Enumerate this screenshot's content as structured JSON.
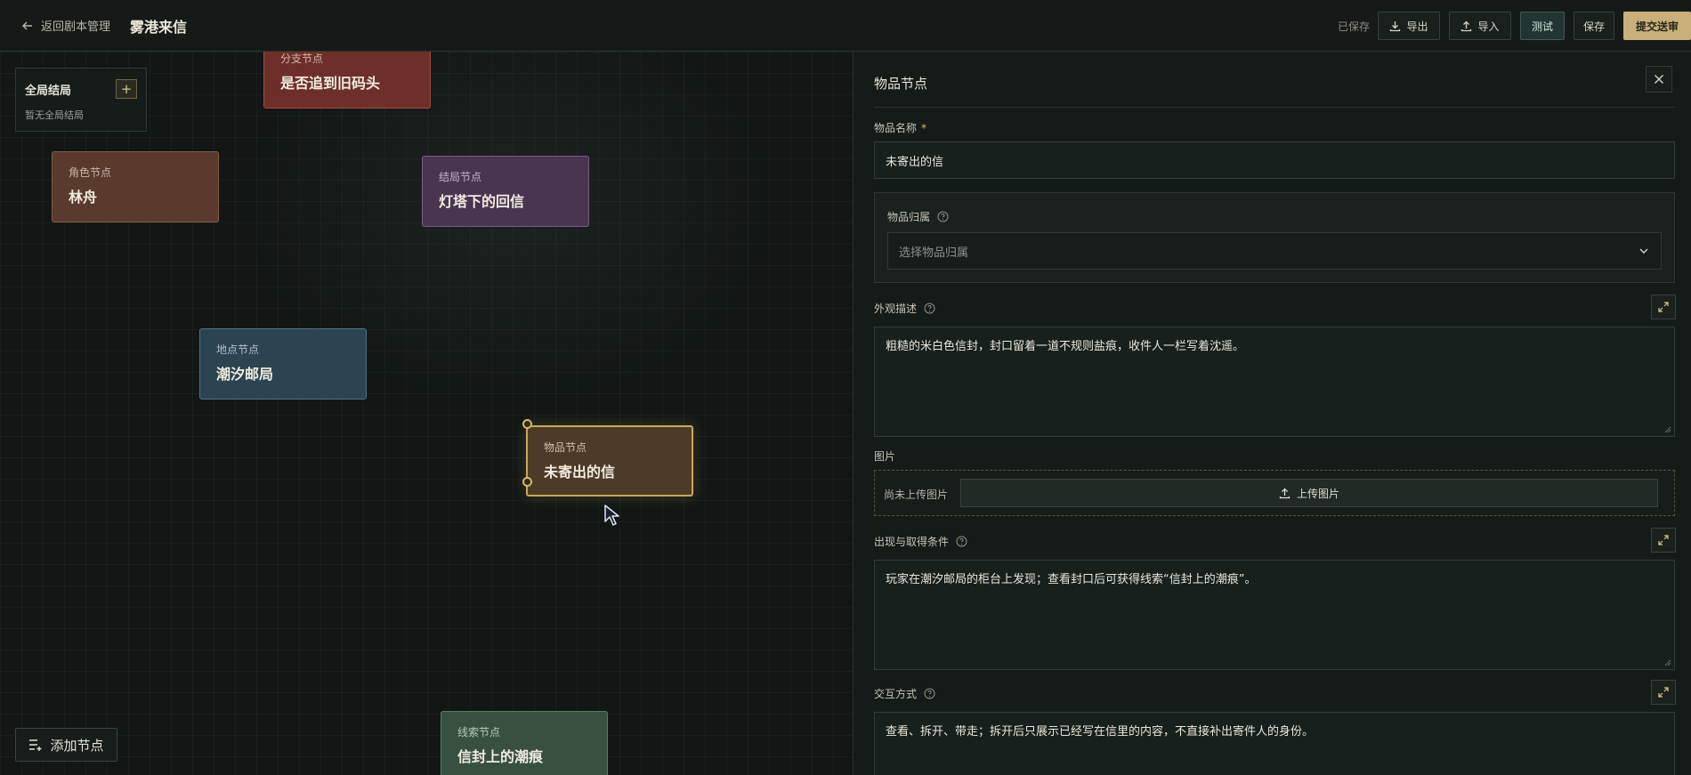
{
  "header": {
    "back_label": "返回剧本管理",
    "title": "雾港来信",
    "saved_status": "已保存",
    "export_label": "导出",
    "import_label": "导入",
    "test_label": "测试",
    "save_label": "保存",
    "submit_label": "提交送审"
  },
  "canvas": {
    "global_endings": {
      "title": "全局结局",
      "add_label": "+",
      "empty_text": "暂无全局结局"
    },
    "nodes": [
      {
        "type_label": "分支节点",
        "name": "是否追到旧码头"
      },
      {
        "type_label": "角色节点",
        "name": "林舟"
      },
      {
        "type_label": "结局节点",
        "name": "灯塔下的回信"
      },
      {
        "type_label": "地点节点",
        "name": "潮汐邮局"
      },
      {
        "type_label": "物品节点",
        "name": "未寄出的信"
      },
      {
        "type_label": "线索节点",
        "name": "信封上的潮痕"
      }
    ],
    "add_node_label": "添加节点"
  },
  "panel": {
    "title": "物品节点",
    "name_field": {
      "label": "物品名称",
      "required_mark": "*",
      "value": "未寄出的信"
    },
    "owner_field": {
      "label": "物品归属",
      "placeholder": "选择物品归属"
    },
    "appearance_field": {
      "label": "外观描述",
      "value": "粗糙的米白色信封，封口留着一道不规则盐痕，收件人一栏写着沈遥。"
    },
    "image_field": {
      "label": "图片",
      "empty_text": "尚未上传图片",
      "upload_label": "上传图片"
    },
    "condition_field": {
      "label": "出现与取得条件",
      "value": "玩家在潮汐邮局的柜台上发现；查看封口后可获得线索“信封上的潮痕”。"
    },
    "interaction_field": {
      "label": "交互方式",
      "value": "查看、拆开、带走；拆开后只展示已经写在信里的内容，不直接补出寄件人的身份。"
    }
  },
  "colors": {
    "accent_gold": "#c9b07a",
    "selected_border": "#c9a85a",
    "test_button": "#233530"
  }
}
